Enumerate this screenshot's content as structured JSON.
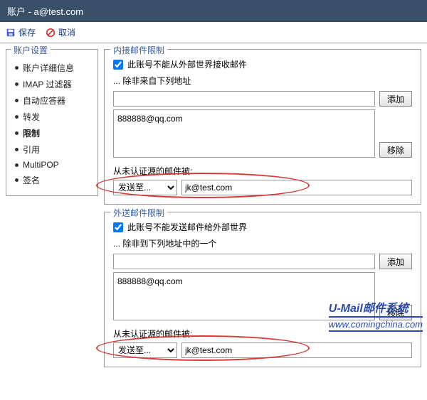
{
  "titlebar": {
    "text": "账户 - a@test.com"
  },
  "toolbar": {
    "save_label": "保存",
    "cancel_label": "取消"
  },
  "sidebar": {
    "legend": "账户设置",
    "items": [
      {
        "label": "账户详细信息"
      },
      {
        "label": "IMAP 过滤器"
      },
      {
        "label": "自动应答器"
      },
      {
        "label": "转发"
      },
      {
        "label": "限制"
      },
      {
        "label": "引用"
      },
      {
        "label": "MultiPOP"
      },
      {
        "label": "签名"
      }
    ],
    "active_index": 4
  },
  "incoming": {
    "legend": "内接邮件限制",
    "checkbox_label": "此账号不能从外部世界接收邮件",
    "checked": true,
    "except_label": "... 除非来自下列地址",
    "add_button": "添加",
    "remove_button": "移除",
    "input_value": "",
    "list_items": [
      "888888@qq.com"
    ],
    "auth_label": "从未认证源的邮件被:",
    "auth_action_options": [
      "发送至..."
    ],
    "auth_action_selected": "发送至...",
    "auth_target": "jk@test.com"
  },
  "outgoing": {
    "legend": "外送邮件限制",
    "checkbox_label": "此账号不能发送邮件给外部世界",
    "checked": true,
    "except_label": "... 除非到下列地址中的一个",
    "add_button": "添加",
    "remove_button": "移除",
    "input_value": "",
    "list_items": [
      "888888@qq.com"
    ],
    "auth_label": "从未认证源的邮件被:",
    "auth_action_options": [
      "发送至..."
    ],
    "auth_action_selected": "发送至...",
    "auth_target": "jk@test.com"
  },
  "watermark": {
    "title": "U-Mail邮件系统",
    "url": "www.comingchina.com"
  }
}
